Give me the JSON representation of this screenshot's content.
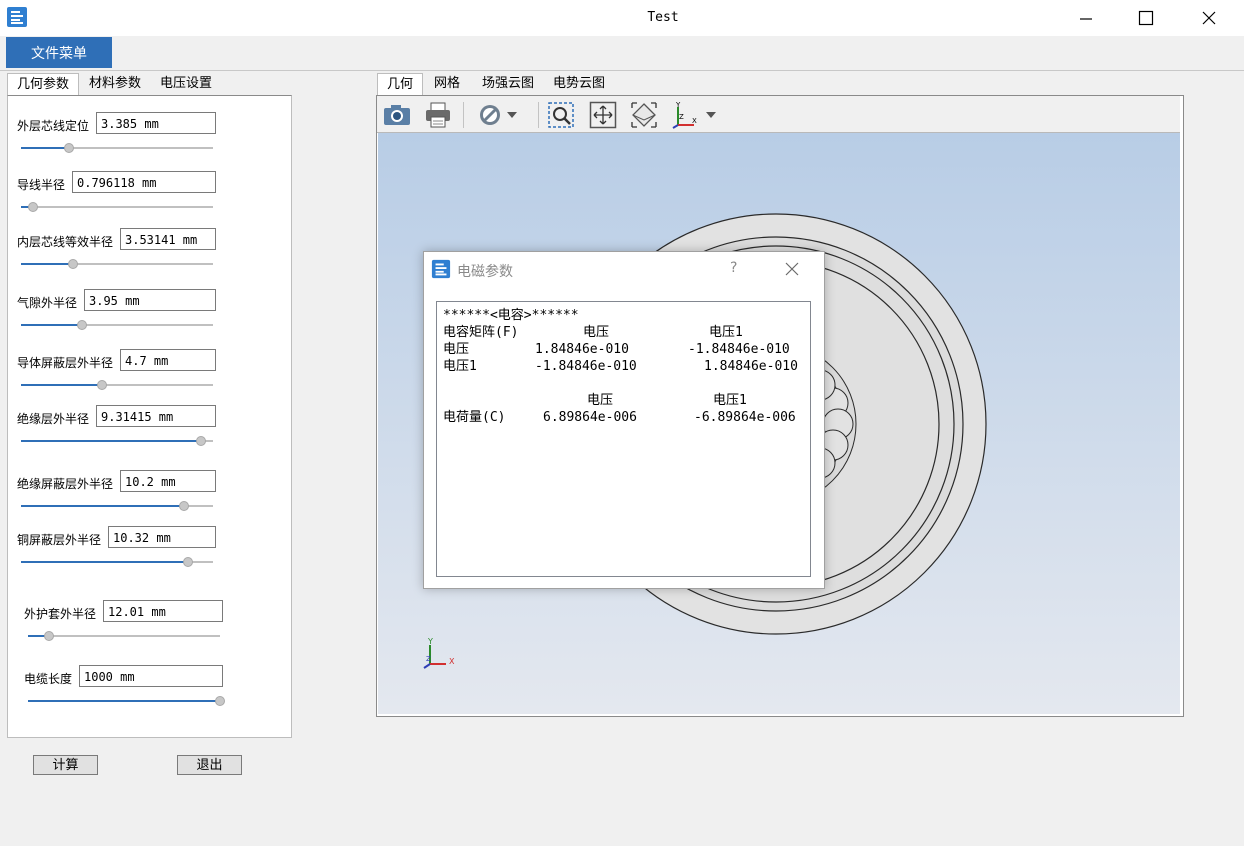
{
  "window": {
    "title": "Test",
    "minimize_icon": "minimize-icon",
    "maximize_icon": "maximize-icon",
    "close_icon": "close-icon"
  },
  "menu": {
    "file": "文件菜单"
  },
  "left_tabs": [
    "几何参数",
    "材料参数",
    "电压设置"
  ],
  "right_tabs": [
    "几何",
    "网格",
    "场强云图",
    "电势云图"
  ],
  "params": [
    {
      "label": "外层芯线定位",
      "value": "3.385 mm",
      "slider": 0.25
    },
    {
      "label": "导线半径",
      "value": "0.796118 mm",
      "slider": 0.06
    },
    {
      "label": "内层芯线等效半径",
      "value": "3.53141 mm",
      "slider": 0.27
    },
    {
      "label": "气隙外半径",
      "value": "3.95 mm",
      "slider": 0.32
    },
    {
      "label": "导体屏蔽层外半径",
      "value": "4.7 mm",
      "slider": 0.42
    },
    {
      "label": "绝缘层外半径",
      "value": "9.31415 mm",
      "slider": 0.94
    },
    {
      "label": "绝缘屏蔽层外半径",
      "value": "10.2 mm",
      "slider": 0.85
    },
    {
      "label": "铜屏蔽层外半径",
      "value": "10.32 mm",
      "slider": 0.87
    },
    {
      "label": "外护套外半径",
      "value": "12.01 mm",
      "slider": 0.11
    },
    {
      "label": "电缆长度",
      "value": "1000 mm",
      "slider": 1.0
    }
  ],
  "buttons": {
    "compute": "计算",
    "exit": "退出"
  },
  "toolbar_icons": [
    "camera-icon",
    "print-icon",
    "no-entry-icon",
    "dropdown-arrow-icon",
    "zoom-box-icon",
    "fit-view-icon",
    "iso-view-icon",
    "axes-icon",
    "dropdown-arrow-icon"
  ],
  "axes": {
    "x": "X",
    "y": "Y",
    "z": "Z"
  },
  "dialog": {
    "title": "电磁参数",
    "help": "?",
    "header": "******<电容>******",
    "cap_title": "电容矩阵(F)",
    "col1": "电压",
    "col2": "电压1",
    "rows": [
      {
        "name": "电压",
        "v1": "1.84846e-010",
        "v2": "-1.84846e-010"
      },
      {
        "name": "电压1",
        "v1": "-1.84846e-010",
        "v2": "1.84846e-010"
      }
    ],
    "charge_label": "电荷量(C)",
    "charge_v1": "6.89864e-006",
    "charge_v2": "-6.89864e-006"
  },
  "colors": {
    "accent": "#2f6fb7",
    "view_top": "#b8cde6",
    "view_bottom": "#e4e8ef"
  }
}
